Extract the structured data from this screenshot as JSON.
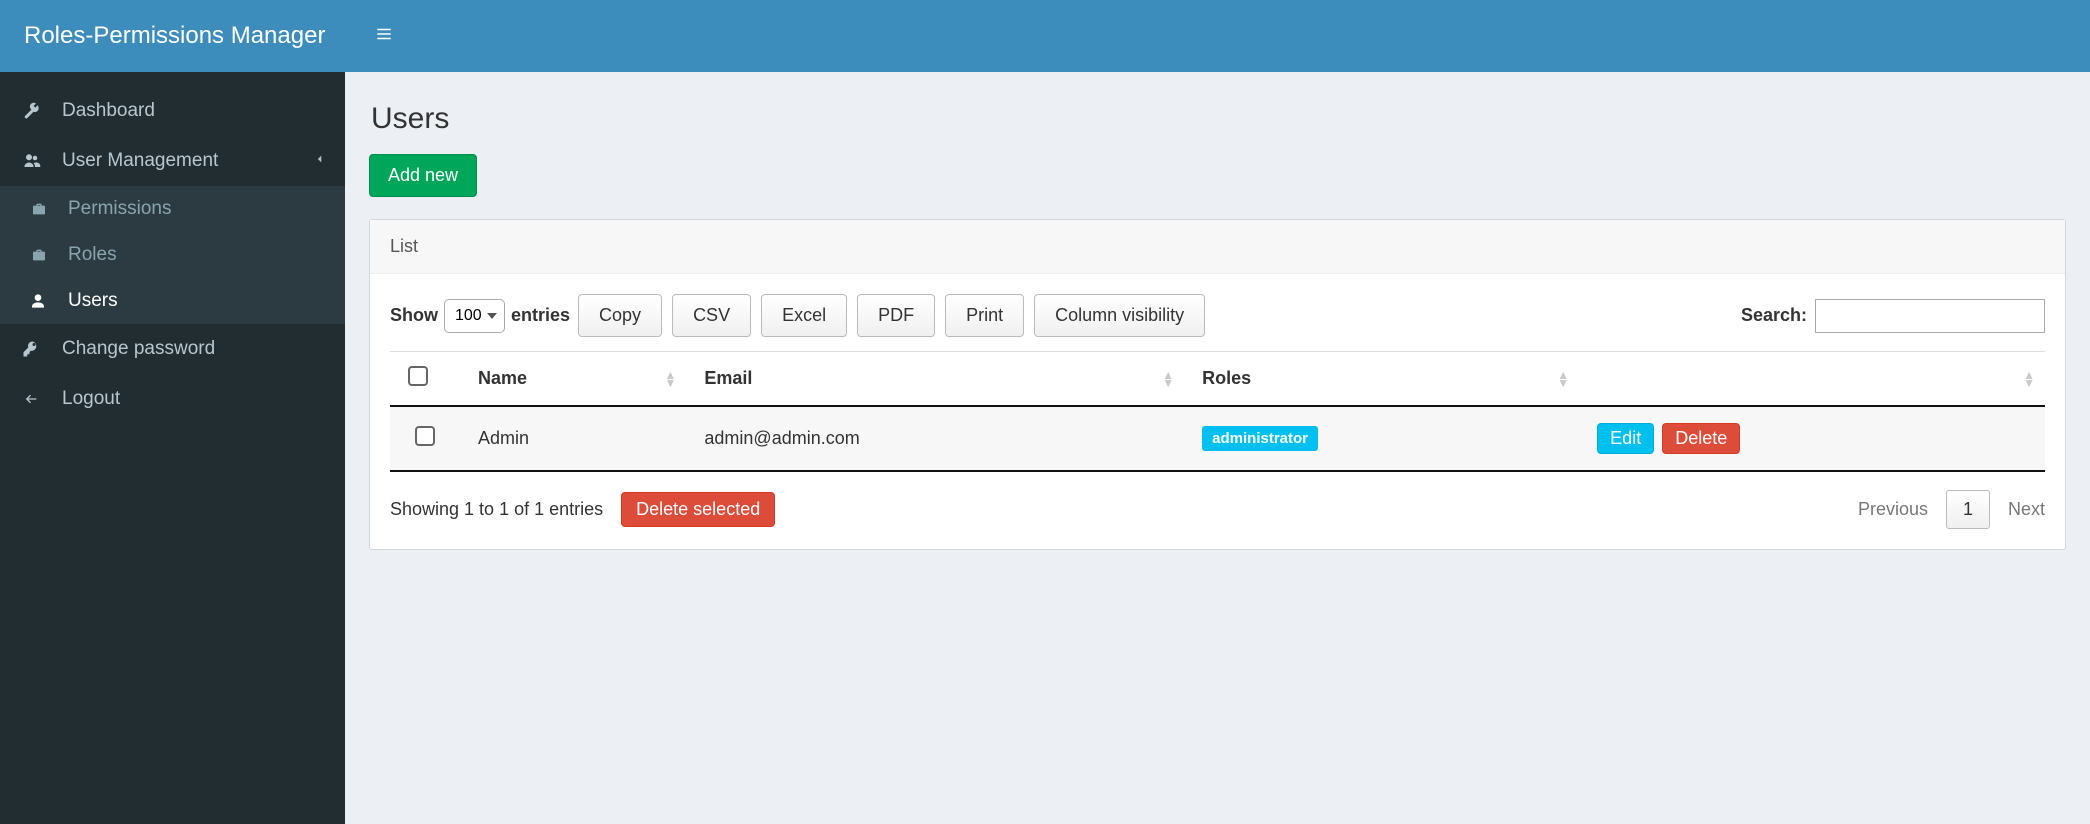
{
  "brand": "Roles-Permissions Manager",
  "sidebar": {
    "items": [
      {
        "label": "Dashboard"
      },
      {
        "label": "User Management"
      },
      {
        "label": "Change password"
      },
      {
        "label": "Logout"
      }
    ],
    "usermgmt_sub": [
      {
        "label": "Permissions"
      },
      {
        "label": "Roles"
      },
      {
        "label": "Users"
      }
    ]
  },
  "page": {
    "title": "Users",
    "add_new": "Add new"
  },
  "panel": {
    "header": "List"
  },
  "table": {
    "length": {
      "show": "Show",
      "value": "100",
      "entries": "entries"
    },
    "export": {
      "copy": "Copy",
      "csv": "CSV",
      "excel": "Excel",
      "pdf": "PDF",
      "print": "Print",
      "colvis": "Column visibility"
    },
    "search_label": "Search:",
    "search_value": "",
    "columns": {
      "name": "Name",
      "email": "Email",
      "roles": "Roles"
    },
    "rows": [
      {
        "name": "Admin",
        "email": "admin@admin.com",
        "role": "administrator"
      }
    ],
    "actions": {
      "edit": "Edit",
      "delete": "Delete"
    },
    "info": "Showing 1 to 1 of 1 entries",
    "delete_selected": "Delete selected",
    "pager": {
      "prev": "Previous",
      "page": "1",
      "next": "Next"
    }
  }
}
